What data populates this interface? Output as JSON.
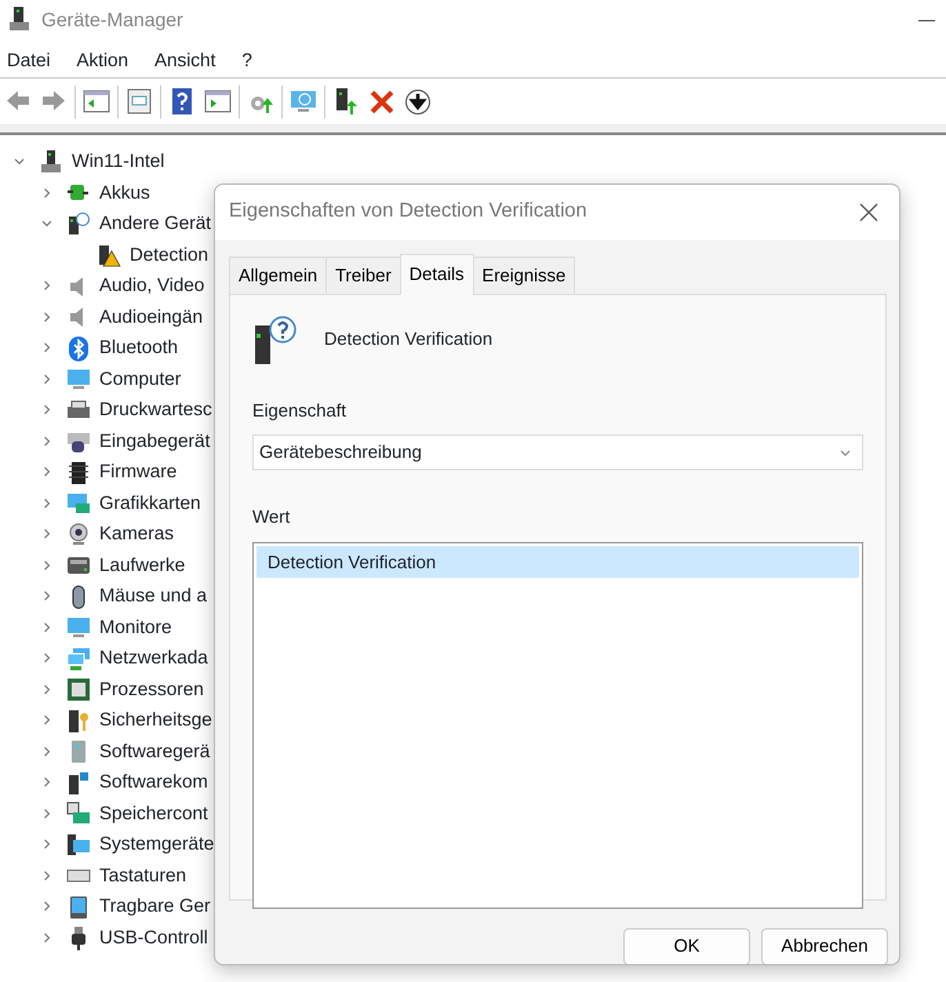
{
  "window": {
    "title": "Geräte-Manager"
  },
  "menu": [
    "Datei",
    "Aktion",
    "Ansicht",
    "?"
  ],
  "tree": {
    "label": "Win11-Intel",
    "expanded": true,
    "children": [
      {
        "label": "Akkus",
        "expanded": false
      },
      {
        "label": "Andere Gerät",
        "expanded": true,
        "children": [
          {
            "label": "Detection"
          }
        ]
      },
      {
        "label": "Audio, Video",
        "expanded": false
      },
      {
        "label": "Audioeingän",
        "expanded": false
      },
      {
        "label": "Bluetooth",
        "expanded": false
      },
      {
        "label": "Computer",
        "expanded": false
      },
      {
        "label": "Druckwartesc",
        "expanded": false
      },
      {
        "label": "Eingabegerät",
        "expanded": false
      },
      {
        "label": "Firmware",
        "expanded": false
      },
      {
        "label": "Grafikkarten",
        "expanded": false
      },
      {
        "label": "Kameras",
        "expanded": false
      },
      {
        "label": "Laufwerke",
        "expanded": false
      },
      {
        "label": "Mäuse und a",
        "expanded": false
      },
      {
        "label": "Monitore",
        "expanded": false
      },
      {
        "label": "Netzwerkada",
        "expanded": false
      },
      {
        "label": "Prozessoren",
        "expanded": false
      },
      {
        "label": "Sicherheitsge",
        "expanded": false
      },
      {
        "label": "Softwaregerä",
        "expanded": false
      },
      {
        "label": "Softwarekom",
        "expanded": false
      },
      {
        "label": "Speichercont",
        "expanded": false
      },
      {
        "label": "Systemgeräte",
        "expanded": false
      },
      {
        "label": "Tastaturen",
        "expanded": false
      },
      {
        "label": "Tragbare Ger",
        "expanded": false
      },
      {
        "label": "USB-Controll",
        "expanded": false
      }
    ]
  },
  "dialog": {
    "title": "Eigenschaften von Detection Verification",
    "tabs": [
      {
        "label": "Allgemein",
        "selected": false
      },
      {
        "label": "Treiber",
        "selected": false
      },
      {
        "label": "Details",
        "selected": true
      },
      {
        "label": "Ereignisse",
        "selected": false
      }
    ],
    "device_name": "Detection Verification",
    "property_label": "Eigenschaft",
    "property_value": "Gerätebeschreibung",
    "value_label": "Wert",
    "values": [
      {
        "text": "Detection Verification",
        "selected": true
      }
    ],
    "buttons": [
      "OK",
      "Abbrechen"
    ]
  }
}
